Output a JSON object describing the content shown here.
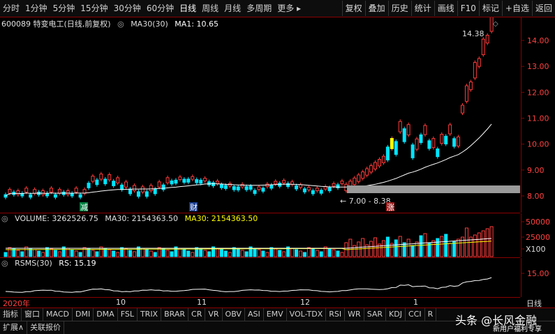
{
  "toolbar": {
    "periods": [
      "分时",
      "1分钟",
      "5分钟",
      "15分钟",
      "30分钟",
      "60分钟",
      "日线",
      "周线",
      "月线",
      "多周期",
      "更多"
    ],
    "actions": [
      "复权",
      "叠加",
      "历史",
      "统计",
      "画线",
      "F10",
      "标记",
      "+自选",
      "返回"
    ]
  },
  "main": {
    "title": "600089 特变电工(日线,前复权)",
    "ma_label": "MA30(30)",
    "ma_value": "MA1: 10.65",
    "price_axis": [
      "14.00",
      "13.00",
      "12.00",
      "11.00",
      "10.00",
      "9.00",
      "8.00"
    ],
    "high_label": "14.38",
    "low_label": "7.00 - 8.38",
    "marker_jian": "减",
    "marker_cai": "财",
    "marker_zhang": "涨",
    "colors": {
      "up": "#ff3b3b",
      "down": "#00e5ff",
      "ma": "#ffffff",
      "highlight": "#ffff00"
    }
  },
  "volume": {
    "label": "VOLUME: 3262526.75",
    "ma_label": "MA30: 2154363.50",
    "ma_label2": "MA30: 2154363.50",
    "axis": [
      "50000",
      "25000",
      "X100"
    ]
  },
  "rsms": {
    "label": "RSMS(30)",
    "value": "RS: 15.19",
    "axis": [
      "15.00"
    ]
  },
  "dates": {
    "year": "2020年",
    "m10": "10",
    "m11": "11",
    "m12": "12",
    "m1": "1",
    "period": "日线"
  },
  "tabs": [
    "指标",
    "窗口",
    "MACD",
    "DMI",
    "DMA",
    "FSL",
    "TRIX",
    "BRAR",
    "CR",
    "VR",
    "OBV",
    "ASI",
    "EMV",
    "VOL-TDX",
    "RSI",
    "WR",
    "SAR",
    "KDJ",
    "CCI",
    "R"
  ],
  "tabs2": [
    "扩展∧",
    "关联报价"
  ],
  "watermark": "头条 @长风金融",
  "footer_note": "新用户福利专享"
}
